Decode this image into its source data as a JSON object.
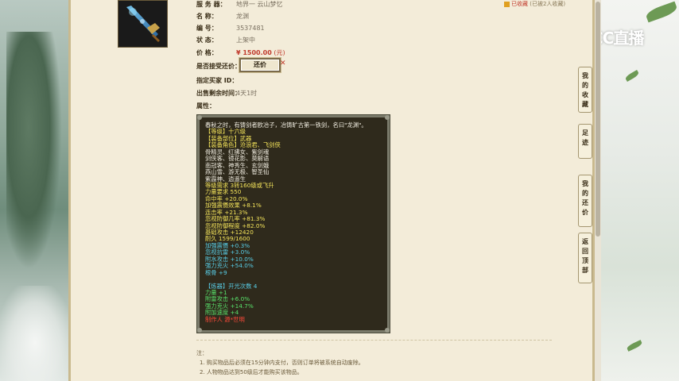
{
  "brand": {
    "logo_text": "CC直播"
  },
  "favorite": {
    "label": "已收藏",
    "count_text": "(已被2人收藏)"
  },
  "item": {
    "server_label": "服 务 器：",
    "server_value": "地界一  云山梦忆",
    "name_label": "名       称：",
    "name_value": "龙渊",
    "id_label": "编       号：",
    "id_value": "3537481",
    "status_label": "状       态：",
    "status_value": "上架中",
    "price_label": "价       格：",
    "price_value": "¥ 1500.00",
    "price_unit": "(元)",
    "counter_label": "是否接受还价：",
    "counter_button": "还价",
    "buyer_label": "指定买家 ID：",
    "buyer_value": "",
    "time_label": "出售剩余时间：",
    "time_value": "4天1时",
    "attr_label": "属性："
  },
  "attributes": [
    {
      "text": "春秋之时，有铸剑者欧冶子，冶铸旷古第一铁剑，名曰\"龙渊\"。",
      "color": "white"
    },
    {
      "text": "【等级】十六级",
      "color": "yellow"
    },
    {
      "text": "【装备部位】武器",
      "color": "yellow"
    },
    {
      "text": "【装备角色】沧浪君、飞剑侠",
      "color": "yellow"
    },
    {
      "text": "骨精灵、红拂女、紫剑魂",
      "color": "white"
    },
    {
      "text": "剑侠客、镜花影、莫解语",
      "color": "white"
    },
    {
      "text": "南冠客、神秀生、玄剑娥",
      "color": "white"
    },
    {
      "text": "燕山雪、游无极、智圣仙",
      "color": "white"
    },
    {
      "text": "紫霞神、逍遥生",
      "color": "white"
    },
    {
      "text": "等级需求 3转160级或飞升",
      "color": "yellow"
    },
    {
      "text": "力量要求 550",
      "color": "yellow"
    },
    {
      "text": "命中率 +20.0%",
      "color": "yellow"
    },
    {
      "text": "加强震慑效果 +8.1%",
      "color": "yellow"
    },
    {
      "text": "连击率 +21.3%",
      "color": "yellow"
    },
    {
      "text": "忽视防御几率 +81.3%",
      "color": "yellow"
    },
    {
      "text": "忽视防御程度 +82.0%",
      "color": "yellow"
    },
    {
      "text": "基础攻击 +12420",
      "color": "yellow"
    },
    {
      "text": "耐久 1599/1600",
      "color": "yellow"
    },
    {
      "text": "加强震慑 +0.3%",
      "color": "blue"
    },
    {
      "text": "忽视抗雷 +3.0%",
      "color": "blue"
    },
    {
      "text": "附水攻击 +10.0%",
      "color": "blue"
    },
    {
      "text": "强力克火 +54.0%",
      "color": "blue"
    },
    {
      "text": "根骨 +9",
      "color": "blue"
    },
    {
      "text": "",
      "color": "gap"
    },
    {
      "text": "【炼器】开光次数 4",
      "color": "blue"
    },
    {
      "text": "力量 +1",
      "color": "green"
    },
    {
      "text": "附雷攻击 +6.0%",
      "color": "green"
    },
    {
      "text": "强力克火 +14.7%",
      "color": "green"
    },
    {
      "text": "附加速度 +4",
      "color": "green"
    },
    {
      "text": "制作人 源*世明",
      "color": "red"
    }
  ],
  "notes": {
    "title": "注：",
    "line1": "1. 购买物品后必须在15分钟内支付，否则订单将被系统自动废除。",
    "line2": "2. 人物物品达到50级后才能购买该物品。"
  },
  "sidenav": [
    {
      "label": "我的收藏"
    },
    {
      "label": "足迹"
    },
    {
      "label": "我的还价"
    },
    {
      "label": "返回顶部"
    }
  ]
}
